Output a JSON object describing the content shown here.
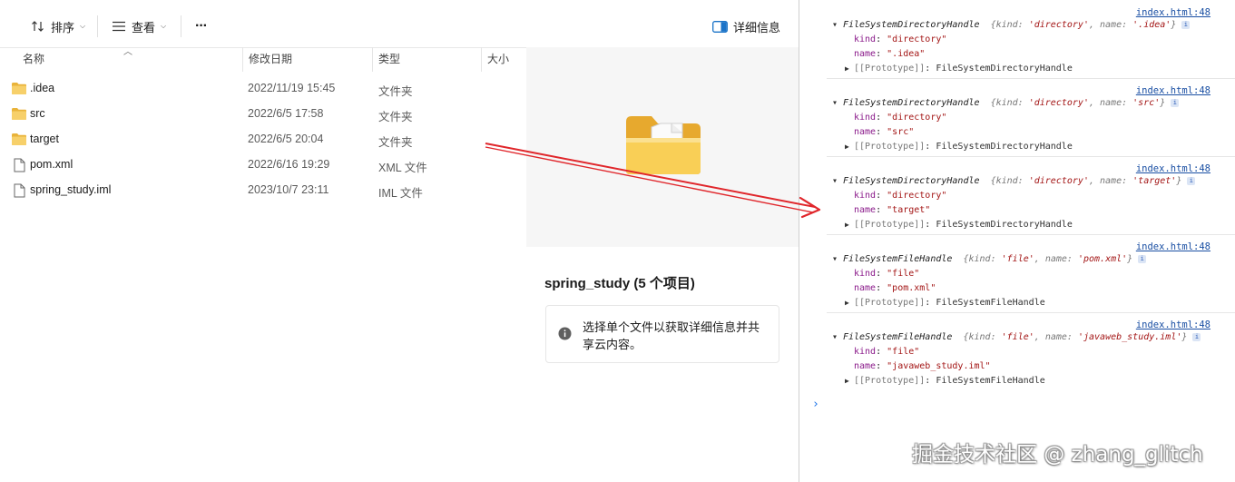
{
  "explorer": {
    "toolbar": {
      "sort_label": "排序",
      "view_label": "查看",
      "more_label": "···",
      "details_label": "详细信息"
    },
    "columns": {
      "name": "名称",
      "modified": "修改日期",
      "type": "类型",
      "size": "大小"
    },
    "rows": [
      {
        "name": ".idea",
        "modified": "2022/11/19 15:45",
        "type": "文件夹",
        "icon": "folder-icon"
      },
      {
        "name": "src",
        "modified": "2022/6/5 17:58",
        "type": "文件夹",
        "icon": "folder-icon"
      },
      {
        "name": "target",
        "modified": "2022/6/5 20:04",
        "type": "文件夹",
        "icon": "folder-icon"
      },
      {
        "name": "pom.xml",
        "modified": "2022/6/16 19:29",
        "type": "XML 文件",
        "icon": "file-icon"
      },
      {
        "name": "spring_study.iml",
        "modified": "2023/10/7 23:11",
        "type": "IML 文件",
        "icon": "file-icon"
      }
    ],
    "details": {
      "title": "spring_study (5 个项目)",
      "message": "选择单个文件以获取详细信息并共享云内容。"
    }
  },
  "console": {
    "entries": [
      {
        "source": "index.html:48",
        "handle": "FileSystemDirectoryHandle",
        "kind": "directory",
        "name": ".idea",
        "proto": "FileSystemDirectoryHandle"
      },
      {
        "source": "index.html:48",
        "handle": "FileSystemDirectoryHandle",
        "kind": "directory",
        "name": "src",
        "proto": "FileSystemDirectoryHandle"
      },
      {
        "source": "index.html:48",
        "handle": "FileSystemDirectoryHandle",
        "kind": "directory",
        "name": "target",
        "proto": "FileSystemDirectoryHandle"
      },
      {
        "source": "index.html:48",
        "handle": "FileSystemFileHandle",
        "kind": "file",
        "name": "pom.xml",
        "proto": "FileSystemFileHandle"
      },
      {
        "source": "index.html:48",
        "handle": "FileSystemFileHandle",
        "kind": "file",
        "name": "javaweb_study.iml",
        "proto": "FileSystemFileHandle"
      }
    ],
    "prompt": "›"
  },
  "watermark": "掘金技术社区 @ zhang_glitch",
  "colors": {
    "folder": "#f2c14e",
    "arrow": "#e0262b",
    "link": "#1a4fa3",
    "string": "#a31515",
    "key": "#8a1a8a"
  }
}
